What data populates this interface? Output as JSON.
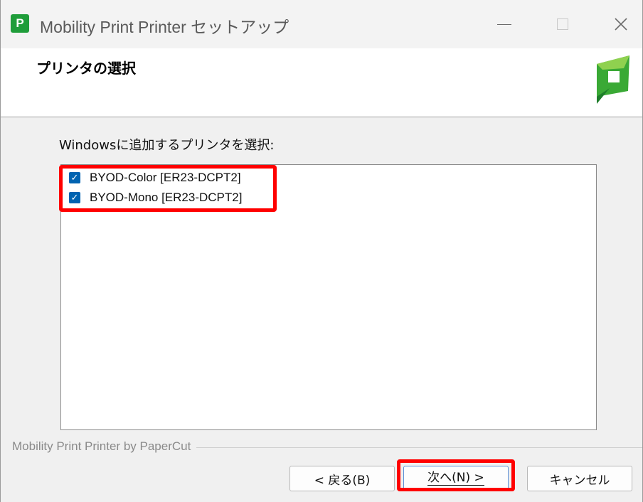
{
  "window": {
    "title": "Mobility Print Printer セットアップ",
    "app_icon_letter": "P"
  },
  "header": {
    "title": "プリンタの選択"
  },
  "main": {
    "instruction": "Windowsに追加するプリンタを選択:",
    "printers": [
      {
        "label": "BYOD-Color [ER23-DCPT2]",
        "checked": true
      },
      {
        "label": "BYOD-Mono [ER23-DCPT2]",
        "checked": true
      }
    ]
  },
  "footer": {
    "brand": "Mobility Print Printer by PaperCut",
    "back_label": "< 戻る(B)",
    "next_label": "次へ(N) >",
    "cancel_label": "キャンセル"
  },
  "colors": {
    "brand_green": "#1f9d3a",
    "checkbox_blue": "#0063b1",
    "highlight_red": "#ff0000"
  }
}
